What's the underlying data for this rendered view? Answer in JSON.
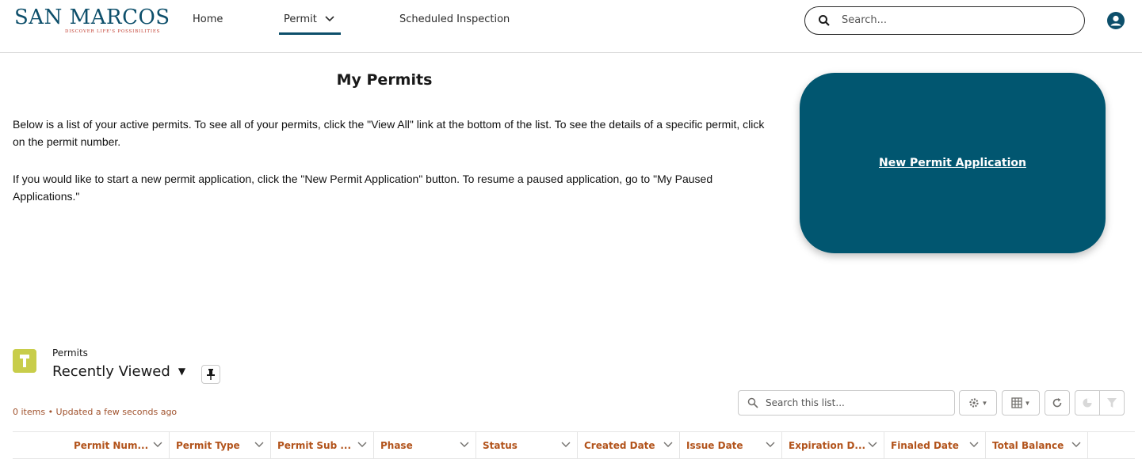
{
  "header": {
    "logo_text": "SAN MARCOS",
    "logo_tagline": "DISCOVER LIFE'S POSSIBILITIES",
    "nav": [
      {
        "label": "Home"
      },
      {
        "label": "Permit"
      },
      {
        "label": "Scheduled Inspection"
      }
    ],
    "active_nav": "Permit",
    "search_placeholder": "Search..."
  },
  "main": {
    "title": "My Permits",
    "paragraph1": "Below is a list of your active permits. To see all of your permits, click the \"View All\" link at the bottom of the list. To see the details of a specific permit, click on the permit number.",
    "paragraph2": "If you would like to start a new permit application, click the  \"New Permit Application\" button.  To resume a paused application, go to \"My Paused Applications.\"",
    "new_permit_button": "New Permit Application"
  },
  "list_view": {
    "object_label": "Permits",
    "view_name": "Recently Viewed",
    "meta": "0 items • Updated a few seconds ago",
    "search_placeholder": "Search this list...",
    "columns": [
      {
        "label": "Permit Num..."
      },
      {
        "label": "Permit Type"
      },
      {
        "label": "Permit Sub ..."
      },
      {
        "label": "Phase"
      },
      {
        "label": "Status"
      },
      {
        "label": "Created Date"
      },
      {
        "label": "Issue Date"
      },
      {
        "label": "Expiration D..."
      },
      {
        "label": "Finaled Date"
      },
      {
        "label": "Total Balance"
      }
    ]
  },
  "colors": {
    "brand": "#015670",
    "header_text": "#b2531b",
    "object_icon": "#c8cd4a"
  }
}
